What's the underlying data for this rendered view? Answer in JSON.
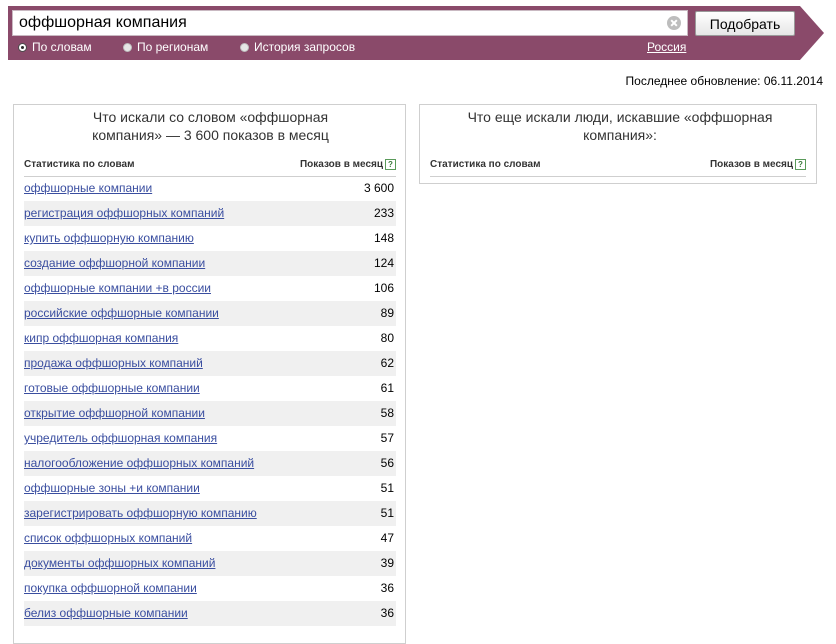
{
  "search": {
    "value": "оффшорная компания",
    "button_label": "Подобрать"
  },
  "modes": [
    {
      "label": "По словам",
      "checked": true
    },
    {
      "label": "По регионам",
      "checked": false
    },
    {
      "label": "История запросов",
      "checked": false
    }
  ],
  "region": "Россия",
  "last_update": "Последнее обновление: 06.11.2014",
  "left_panel": {
    "title_line1": "Что искали со словом «оффшорная",
    "title_line2": "компания» — 3 600 показов в месяц",
    "col_phrase": "Статистика по словам",
    "col_count": "Показов в месяц",
    "rows": [
      {
        "phrase": "оффшорные компании",
        "count": "3 600"
      },
      {
        "phrase": "регистрация оффшорных компаний",
        "count": "233"
      },
      {
        "phrase": "купить оффшорную компанию",
        "count": "148"
      },
      {
        "phrase": "создание оффшорной компании",
        "count": "124"
      },
      {
        "phrase": "оффшорные компании +в россии",
        "count": "106"
      },
      {
        "phrase": "российские оффшорные компании",
        "count": "89"
      },
      {
        "phrase": "кипр оффшорная компания",
        "count": "80"
      },
      {
        "phrase": "продажа оффшорных компаний",
        "count": "62"
      },
      {
        "phrase": "готовые оффшорные компании",
        "count": "61"
      },
      {
        "phrase": "открытие оффшорной компании",
        "count": "58"
      },
      {
        "phrase": "учредитель оффшорная компания",
        "count": "57"
      },
      {
        "phrase": "налогообложение оффшорных компаний",
        "count": "56"
      },
      {
        "phrase": "оффшорные зоны +и компании",
        "count": "51"
      },
      {
        "phrase": "зарегистрировать оффшорную компанию",
        "count": "51"
      },
      {
        "phrase": "список оффшорных компаний",
        "count": "47"
      },
      {
        "phrase": "документы оффшорных компаний",
        "count": "39"
      },
      {
        "phrase": "покупка оффшорной компании",
        "count": "36"
      },
      {
        "phrase": "белиз оффшорные компании",
        "count": "36"
      }
    ]
  },
  "right_panel": {
    "title_line1": "Что еще искали люди, искавшие «оффшорная",
    "title_line2": "компания»:",
    "col_phrase": "Статистика по словам",
    "col_count": "Показов в месяц"
  },
  "help_glyph": "?",
  "colors": {
    "header": "#8a4a6a",
    "link": "#3a4ea0",
    "row_shade": "#f0f0f0"
  }
}
